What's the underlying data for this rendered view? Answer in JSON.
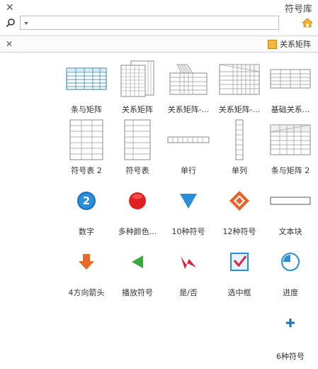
{
  "panel": {
    "title": "符号库"
  },
  "search": {
    "placeholder": "",
    "value": ""
  },
  "tag": {
    "label": "关系矩阵"
  },
  "shapes": [
    {
      "label": "基础关系...",
      "icon": "basic-relation-matrix-icon"
    },
    {
      "label": "关系矩阵-...",
      "icon": "relation-matrix-icon"
    },
    {
      "label": "关系矩阵-...",
      "icon": "relation-matrix-perspective-icon"
    },
    {
      "label": "关系矩阵",
      "icon": "relation-matrix-stack-icon"
    },
    {
      "label": "条与矩阵",
      "icon": "bar-matrix-icon"
    },
    {
      "label": "条与矩阵 2",
      "icon": "bar-matrix-2-icon"
    },
    {
      "label": "单列",
      "icon": "single-column-icon"
    },
    {
      "label": "单行",
      "icon": "single-row-icon"
    },
    {
      "label": "符号表",
      "icon": "symbol-table-icon"
    },
    {
      "label": "符号表 2",
      "icon": "symbol-table-2-icon"
    },
    {
      "label": "文本块",
      "icon": "text-block-icon"
    },
    {
      "label": "12种符号",
      "icon": "diamond-symbol-icon"
    },
    {
      "label": "10种符号",
      "icon": "triangle-symbol-icon"
    },
    {
      "label": "多种颜色...",
      "icon": "red-circle-icon"
    },
    {
      "label": "数字",
      "icon": "number-badge-icon"
    },
    {
      "label": "进度",
      "icon": "progress-icon"
    },
    {
      "label": "选中框",
      "icon": "checkbox-icon"
    },
    {
      "label": "是/否",
      "icon": "check-mark-icon"
    },
    {
      "label": "播放符号",
      "icon": "play-icon"
    },
    {
      "label": "4方向箭头",
      "icon": "arrow-down-icon"
    },
    {
      "label": "6种符号",
      "icon": "plus-icon"
    }
  ],
  "badge_number": "2",
  "colors": {
    "accent": "#2a8fd8",
    "red": "#e02020",
    "orange": "#e86a2a",
    "green": "#3aa93a",
    "table": "#1f7fa8"
  }
}
